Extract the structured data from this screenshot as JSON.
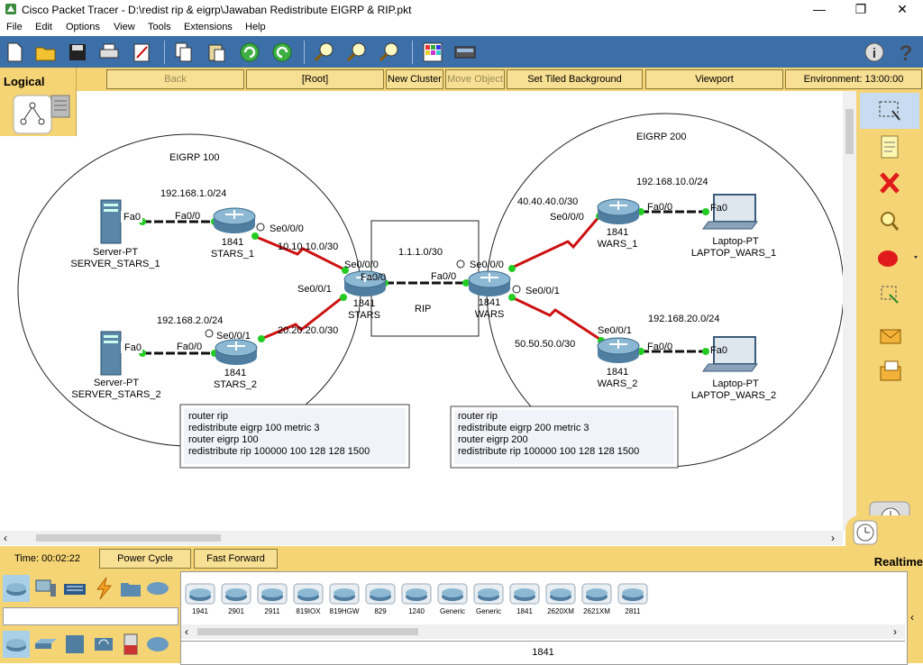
{
  "window": {
    "title": "Cisco Packet Tracer - D:\\redist rip & eigrp\\Jawaban Redistribute EIGRP & RIP.pkt",
    "minimize": "—",
    "maximize": "❐",
    "close": "✕"
  },
  "menu": [
    "File",
    "Edit",
    "Options",
    "View",
    "Tools",
    "Extensions",
    "Help"
  ],
  "toolbar_icons": [
    "new-icon",
    "open-icon",
    "save-icon",
    "print-icon",
    "activity-wizard-icon",
    "copy-icon",
    "paste-icon",
    "undo-icon",
    "redo-icon",
    "zoom-in-icon",
    "zoom-reset-icon",
    "zoom-out-icon",
    "palette-icon",
    "custom-device-icon",
    "info-icon",
    "help-icon"
  ],
  "logical_bar": {
    "mode": "Logical",
    "back": "Back",
    "root": "[Root]",
    "new_cluster": "New Cluster",
    "move_object": "Move Object",
    "set_tiled_background": "Set Tiled Background",
    "viewport": "Viewport",
    "environment": "Environment: 13:00:00"
  },
  "topology": {
    "areas": {
      "eigrp100": "EIGRP 100",
      "eigrp200": "EIGRP 200",
      "rip": "RIP"
    },
    "networks": {
      "net_stars1_lan": "192.168.1.0/24",
      "net_stars2_lan": "192.168.2.0/24",
      "net_stars1_link": "10.10.10.0/30",
      "net_stars2_link": "20.20.20.0/30",
      "net_rip": "1.1.1.0/30",
      "net_wars1_link": "40.40.40.0/30",
      "net_wars2_link": "50.50.50.0/30",
      "net_wars1_lan": "192.168.10.0/24",
      "net_wars2_lan": "192.168.20.0/24"
    },
    "devices": {
      "server1": {
        "model": "Server-PT",
        "name": "SERVER_STARS_1"
      },
      "server2": {
        "model": "Server-PT",
        "name": "SERVER_STARS_2"
      },
      "stars1": {
        "model": "1841",
        "name": "STARS_1"
      },
      "stars2": {
        "model": "1841",
        "name": "STARS_2"
      },
      "stars": {
        "model": "1841",
        "name": "STARS"
      },
      "wars": {
        "model": "1841",
        "name": "WARS"
      },
      "wars1": {
        "model": "1841",
        "name": "WARS_1"
      },
      "wars2": {
        "model": "1841",
        "name": "WARS_2"
      },
      "laptop1": {
        "model": "Laptop-PT",
        "name": "LAPTOP_WARS_1"
      },
      "laptop2": {
        "model": "Laptop-PT",
        "name": "LAPTOP_WARS_2"
      }
    },
    "ports": {
      "server1_fa0": "Fa0",
      "stars1_fa00": "Fa0/0",
      "stars1_se000": "Se0/0/0",
      "server2_fa0": "Fa0",
      "stars2_fa00": "Fa0/0",
      "stars2_se001": "Se0/0/1",
      "stars_se000": "Se0/0/0",
      "stars_fa00": "Fa0/0",
      "stars_se001": "Se0/0/1",
      "wars_fa00": "Fa0/0",
      "wars_se000": "Se0/0/0",
      "wars_se001": "Se0/0/1",
      "wars1_se000": "Se0/0/0",
      "wars1_fa00": "Fa0/0",
      "laptop1_fa0": "Fa0",
      "wars2_se001": "Se0/0/1",
      "wars2_fa00": "Fa0/0",
      "laptop2_fa0": "Fa0"
    },
    "notes": {
      "stars": [
        "router rip",
        "redistribute eigrp 100 metric 3",
        "router eigrp 100",
        "redistribute rip 100000 100 128 128 1500"
      ],
      "wars": [
        "router rip",
        "redistribute eigrp 200 metric 3",
        "router eigrp 200",
        "redistribute rip 100000 100 128 128 1500"
      ]
    }
  },
  "right_tools": [
    "select-icon",
    "note-icon",
    "delete-icon",
    "inspect-icon",
    "draw-ellipse-icon",
    "resize-icon",
    "add-simple-pdu-icon",
    "add-complex-pdu-icon"
  ],
  "timebar": {
    "time": "Time: 00:02:22",
    "power_cycle": "Power Cycle Devices",
    "fast_forward": "Fast Forward Time",
    "realtime": "Realtime"
  },
  "device_models": [
    "1941",
    "2901",
    "2911",
    "819IOX",
    "819HGW",
    "829",
    "1240",
    "Generic",
    "Generic",
    "1841",
    "2620XM",
    "2621XM",
    "2811"
  ],
  "selected_model": "1841",
  "colors": {
    "toolbar_blue": "#3c6fa8",
    "panel_yellow": "#f5d476",
    "serial_link": "#cc1111",
    "link_dot": "#22cc22"
  }
}
